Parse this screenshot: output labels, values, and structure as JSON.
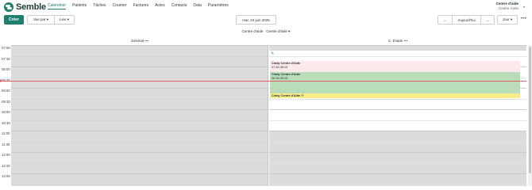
{
  "app": {
    "brand": "Semble"
  },
  "nav": {
    "items": [
      "Calendrier",
      "Patients",
      "Tâches",
      "Courrier",
      "Factures",
      "Actes",
      "Contacts",
      "Data",
      "Paramètres"
    ],
    "active": "Calendrier"
  },
  "user": {
    "name": "Centre d'aide",
    "subtitle": "Centre Cielo"
  },
  "toolbar": {
    "create_label": "Créer",
    "view_by_label": "Vue par ▾",
    "location_label": "Lieu ▾",
    "date_label": "mar. 24 juin 2025",
    "prev_label": "←",
    "today_label": "Aujourd'hui",
    "next_label": "→",
    "view_mode_label": "Jour ▾",
    "more_label": "•••"
  },
  "calendar": {
    "resource_title": "Centre d'aide · Centre d'aide ▾",
    "columns": [
      {
        "label": "Général",
        "menu": "•••"
      },
      {
        "label": "C. D'aide",
        "menu": "•••"
      }
    ],
    "times": [
      "07:00",
      "07:30",
      "08:00",
      "08:30",
      "09:00",
      "09:30",
      "10:00",
      "10:30",
      "11:00",
      "11:30",
      "12:00",
      "12:30",
      "13:00"
    ],
    "events": [
      {
        "title": "Cindy Centre d'Aide",
        "time": "07:45-08:15"
      },
      {
        "title": "Cindy Centre d'Aide",
        "time": "08:15-09:15"
      },
      {
        "title": "Cindy Centre d'Aide",
        "time": "",
        "icon": "⟳"
      }
    ]
  },
  "colors": {
    "brand": "#1f7e6e",
    "now_line": "#e06060",
    "event_pink": "#fde8ea",
    "event_green": "#b9dcb9",
    "event_yellow": "#f7ee8a",
    "closed_grey": "#dcdcdc"
  }
}
